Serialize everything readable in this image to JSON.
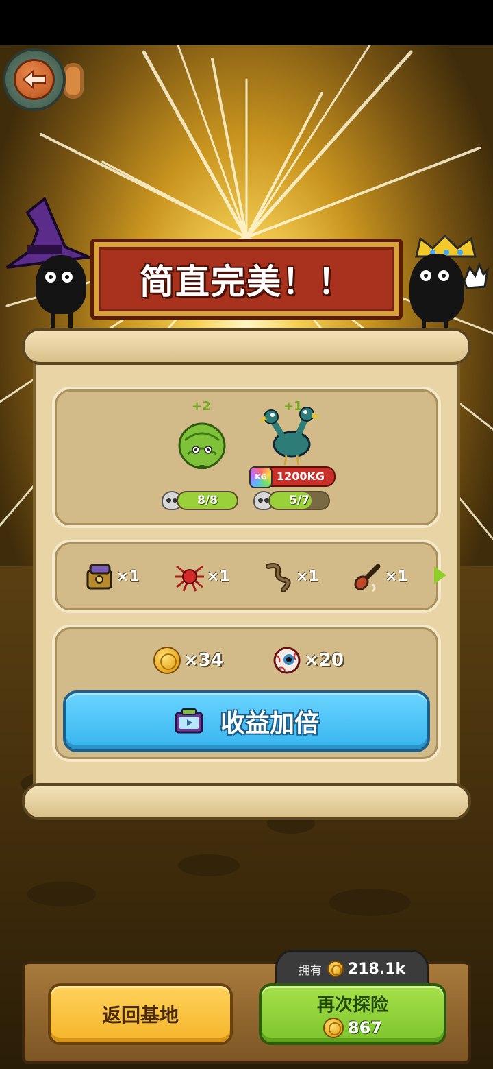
{
  "banner": {
    "title": "简直完美！！"
  },
  "creatures": [
    {
      "name_icon": "lettuce-monster-icon",
      "bonus": "+2",
      "progress_text": "8/8",
      "progress": 1.0
    },
    {
      "name_icon": "two-headed-bird-icon",
      "bonus": "+1",
      "weight": "1200KG",
      "weight_unit_icon": "KG",
      "progress_text": "5/7",
      "progress": 0.714
    }
  ],
  "loot": [
    {
      "icon": "treasure-chest-icon",
      "count": "×1"
    },
    {
      "icon": "red-spider-icon",
      "count": "×1"
    },
    {
      "icon": "worm-icon",
      "count": "×1"
    },
    {
      "icon": "bone-club-icon",
      "count": "×1"
    }
  ],
  "rewards": [
    {
      "icon": "gold-coin-icon",
      "count": "×34"
    },
    {
      "icon": "eyeball-icon",
      "count": "×20"
    }
  ],
  "double_button": {
    "label": "收益加倍",
    "icon": "tv-ad-icon"
  },
  "wallet": {
    "label": "拥有",
    "value": "218.1k"
  },
  "buttons": {
    "home": "返回基地",
    "again": "再次探险",
    "again_cost": "867"
  },
  "colors": {
    "banner_red": "#a8321d",
    "progress_green": "#9ad03a",
    "double_blue": "#36b4ee",
    "home_yellow": "#f4b42a",
    "again_green": "#7cc42c"
  }
}
